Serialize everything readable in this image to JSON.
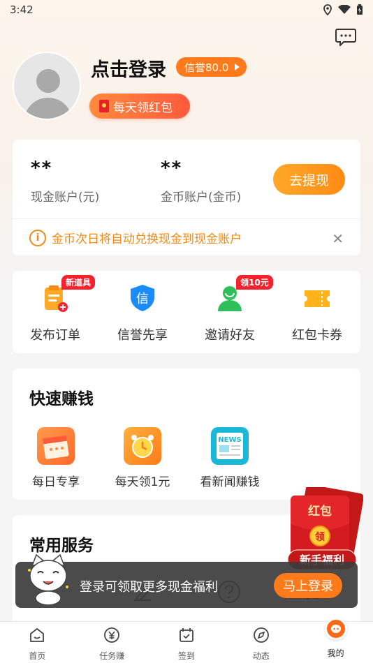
{
  "status_bar": {
    "time": "3:42"
  },
  "profile": {
    "login_text": "点击登录",
    "credit_badge": "信誉80.0",
    "daily_red_packet": "每天领红包"
  },
  "account": {
    "cash_value": "**",
    "cash_label": "现金账户(元)",
    "gold_value": "**",
    "gold_label": "金币账户(金币)",
    "withdraw_label": "去提现",
    "notice": "金币次日将自动兑换现金到现金账户"
  },
  "tools": [
    {
      "label": "发布订单",
      "tag": "新道具"
    },
    {
      "label": "信誉先享",
      "tag": ""
    },
    {
      "label": "邀请好友",
      "tag": "领10元"
    },
    {
      "label": "红包卡券",
      "tag": ""
    }
  ],
  "quick": {
    "title": "快速赚钱",
    "items": [
      {
        "label": "每日专享"
      },
      {
        "label": "每天领1元"
      },
      {
        "label": "看新闻赚钱"
      }
    ]
  },
  "services": {
    "title": "常用服务"
  },
  "float_red_packet": {
    "top_text": "红包",
    "coin_text": "领",
    "ribbon": "新手福利"
  },
  "toast": {
    "text": "登录可领取更多现金福利",
    "button": "马上登录"
  },
  "bottom_nav": [
    {
      "label": "首页",
      "icon": "home-icon"
    },
    {
      "label": "任务赚",
      "icon": "yen-icon"
    },
    {
      "label": "签到",
      "icon": "calendar-check-icon"
    },
    {
      "label": "动态",
      "icon": "compass-icon"
    },
    {
      "label": "我的",
      "icon": "mine-icon"
    }
  ],
  "colors": {
    "accent": "#ff7a1a",
    "notice": "#f08a14",
    "tag_red": "#f5222d"
  }
}
